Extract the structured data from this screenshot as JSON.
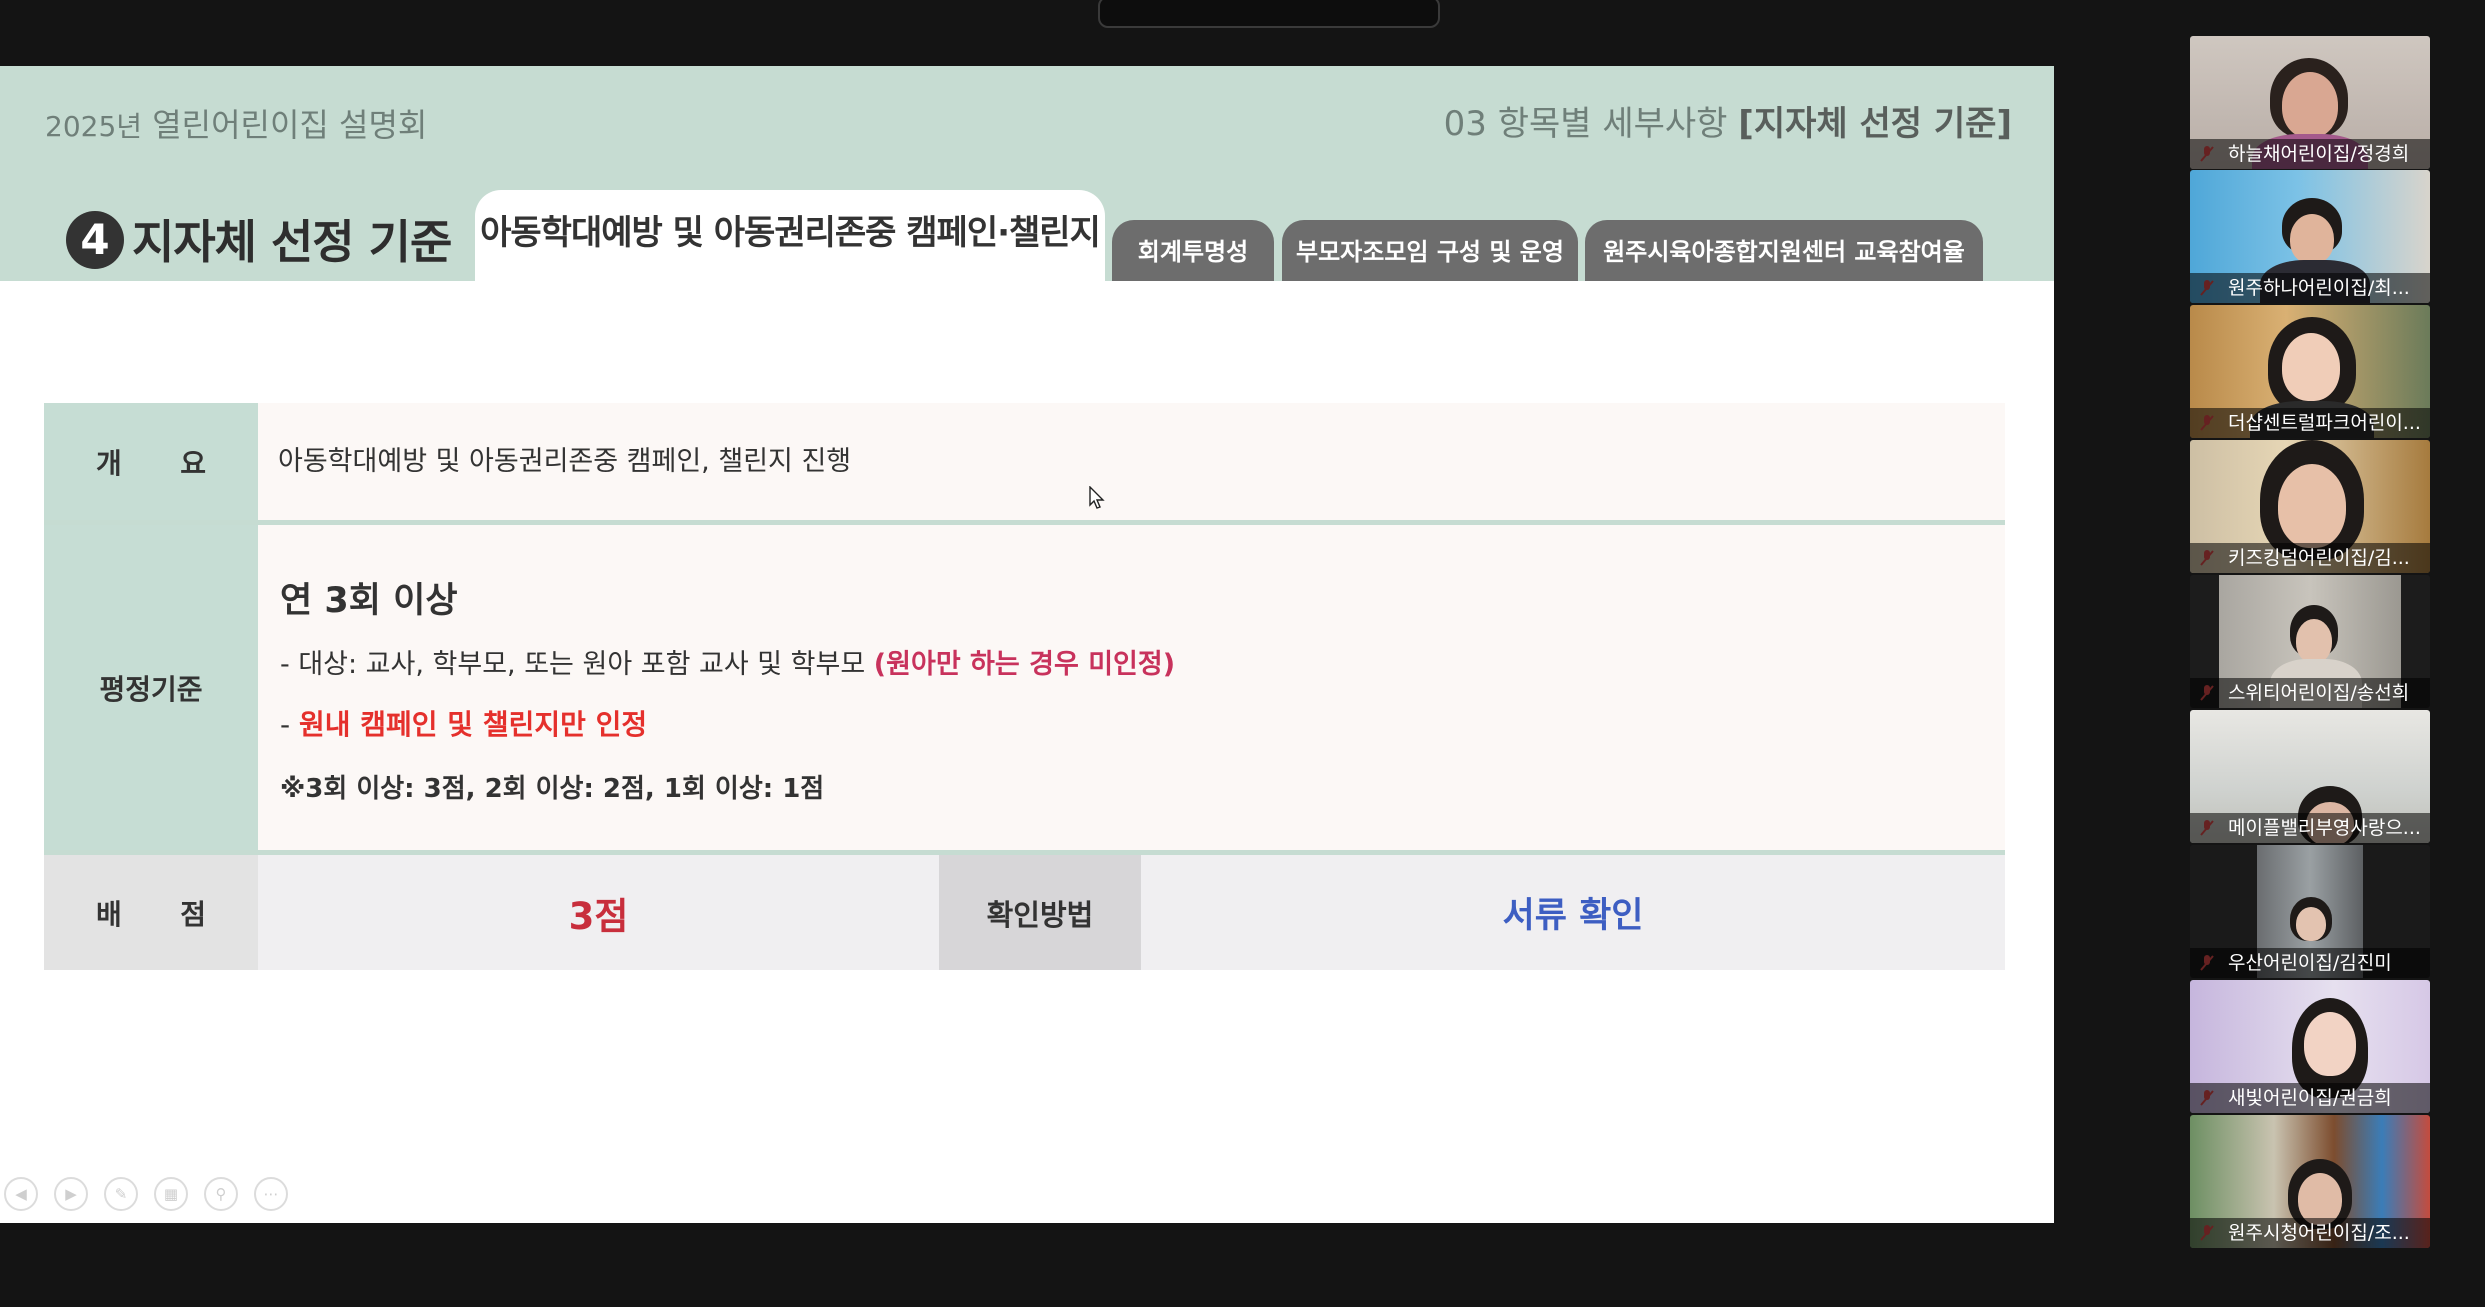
{
  "slide": {
    "event_year": "2025년",
    "event_name": " 열린어린이집 설명회",
    "section_prefix": "03 항목별 세부사항 ",
    "section_bold": "[지자체 선정 기준]",
    "section_number": "4",
    "section_title": "지자체 선정 기준",
    "active_tab": "아동학대예방 및 아동권리존중 캠페인·챌린지",
    "tabs": [
      "회계투명성",
      "부모자조모임 구성 및 운영",
      "원주시육아종합지원센터 교육참여율"
    ],
    "table": {
      "overview_label": "개      요",
      "overview_value": "아동학대예방 및 아동권리존중 캠페인, 챌린지 진행",
      "criteria_label": "평정기준",
      "criteria_heading": "연 3회 이상",
      "criteria_target_prefix": "- 대상: 교사, 학부모, 또는 원아 포함 교사 및 학부모 ",
      "criteria_target_note": "(원아만 하는 경우 미인정)",
      "criteria_dash": "- ",
      "criteria_note": "원내 캠페인 및 챌린지만 인정",
      "criteria_scoring": "※3회 이상: 3점, 2회 이상: 2점, 1회 이상: 1점",
      "score_label": "배      점",
      "score_value": "3점",
      "verify_label": "확인방법",
      "verify_value": "서류 확인"
    },
    "controls": [
      "prev-icon",
      "next-icon",
      "pen-icon",
      "slides-icon",
      "zoom-icon",
      "more-icon"
    ]
  },
  "participants": [
    {
      "name": "하늘채어린이집/정경희",
      "muted": true
    },
    {
      "name": "원주하나어린이집/최...",
      "muted": true
    },
    {
      "name": "더샵센트럴파크어린이...",
      "muted": true
    },
    {
      "name": "키즈킹덤어린이집/김...",
      "muted": true
    },
    {
      "name": "스위티어린이집/송선희",
      "muted": true
    },
    {
      "name": "메이플밸리부영사랑으...",
      "muted": true
    },
    {
      "name": "우산어린이집/김진미",
      "muted": true
    },
    {
      "name": "새빛어린이집/권금희",
      "muted": true
    },
    {
      "name": "원주시청어린이집/조...",
      "muted": true
    }
  ],
  "colors": {
    "header_green": "#c6dcd2",
    "label_green": "#c6ddd4",
    "emphasis_pink": "#c8325c",
    "emphasis_red": "#e5302c",
    "score_red": "#c82e3c",
    "verify_blue": "#3d5ec2"
  }
}
